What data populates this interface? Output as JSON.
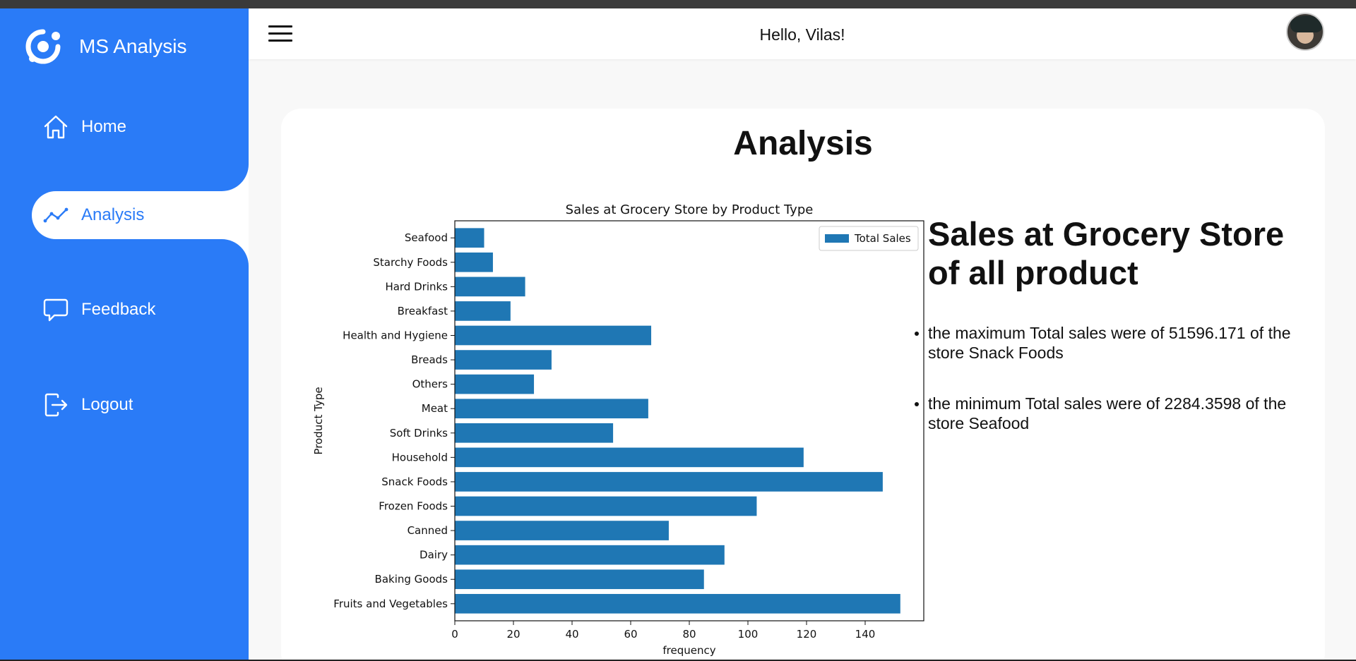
{
  "brand": {
    "name": "MS Analysis",
    "logo_icon": "ring-logo-icon"
  },
  "nav": {
    "items": [
      {
        "label": "Home",
        "icon": "home-icon",
        "active": false
      },
      {
        "label": "Analysis",
        "icon": "line-chart-icon",
        "active": true
      },
      {
        "label": "Feedback",
        "icon": "chat-bubble-icon",
        "active": false
      },
      {
        "label": "Logout",
        "icon": "logout-icon",
        "active": false
      }
    ]
  },
  "header": {
    "greeting": "Hello, Vilas!"
  },
  "card": {
    "title": "Analysis"
  },
  "info": {
    "title": "Sales at Grocery Store of all product",
    "points": [
      "the maximum Total sales were of 51596.171 of the store Snack Foods",
      "the minimum Total sales were of 2284.3598 of the store Seafood"
    ]
  },
  "colors": {
    "sidebar": "#2a7bf7",
    "bar": "#1f77b4",
    "active_text": "#2a7bf7"
  },
  "chart_data": {
    "type": "bar",
    "orientation": "horizontal",
    "title": "Sales at Grocery Store by Product Type",
    "xlabel": "frequency",
    "ylabel": "Product Type",
    "categories": [
      "Seafood",
      "Starchy Foods",
      "Hard Drinks",
      "Breakfast",
      "Health and Hygiene",
      "Breads",
      "Others",
      "Meat",
      "Soft Drinks",
      "Household",
      "Snack Foods",
      "Frozen Foods",
      "Canned",
      "Dairy",
      "Baking Goods",
      "Fruits and Vegetables"
    ],
    "series": [
      {
        "name": "Total Sales",
        "values": [
          10,
          13,
          24,
          19,
          67,
          33,
          27,
          66,
          54,
          119,
          146,
          103,
          73,
          92,
          85,
          152
        ]
      }
    ],
    "xlim": [
      0,
      160
    ],
    "xticks": [
      0,
      20,
      40,
      60,
      80,
      100,
      120,
      140
    ],
    "legend": "top-right",
    "grid": false
  }
}
